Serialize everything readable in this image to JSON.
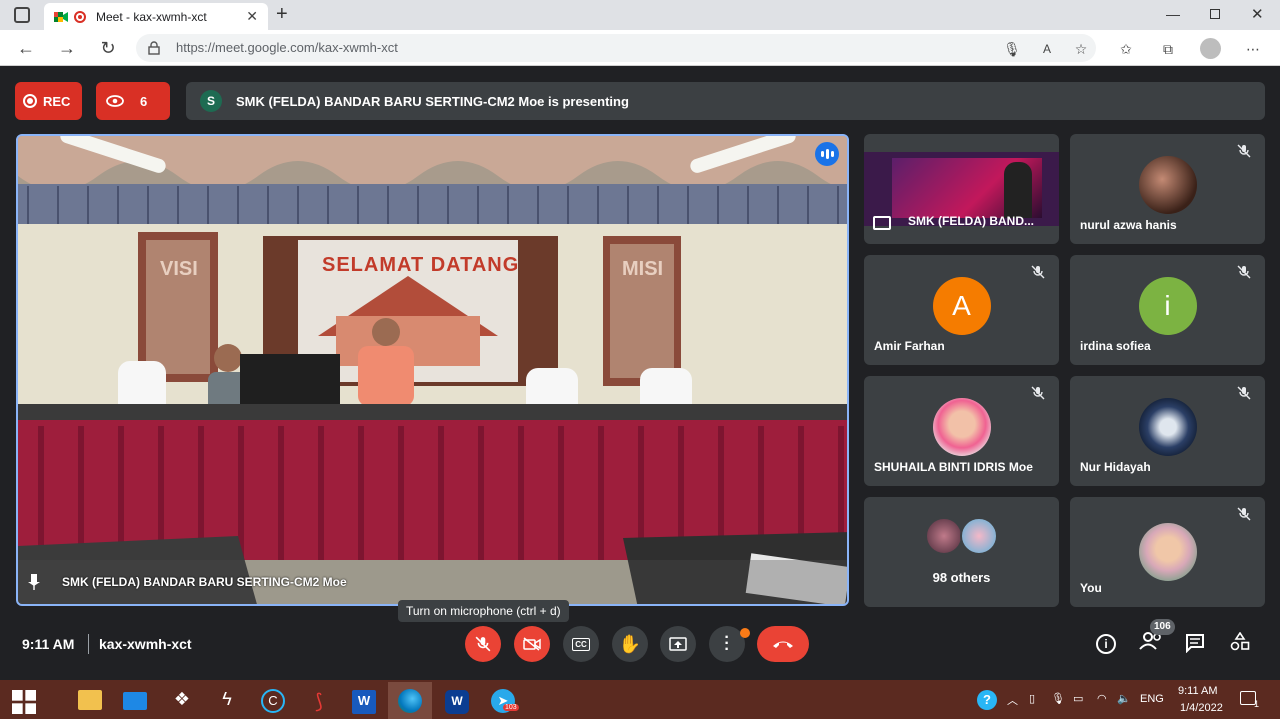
{
  "browser": {
    "tab_title": "Meet - kax-xwmh-xct",
    "new_tab_label": "+",
    "url": "https://meet.google.com/kax-xwmh-xct"
  },
  "meet": {
    "rec_label": "REC",
    "viewers_count": "6",
    "presenter_initial": "S",
    "presenting_text": "SMK (FELDA) BANDAR BARU SERTING-CM2 Moe is presenting",
    "main_video_name": "SMK (FELDA) BANDAR BARU SERTING-CM2 Moe",
    "scene_banner": "SELAMAT DATANG",
    "scene_left_board": "VISI",
    "scene_right_board": "MISI",
    "participants": [
      {
        "name": "SMK (FELDA) BAND...",
        "type": "presentation"
      },
      {
        "name": "nurul azwa hanis",
        "type": "photo"
      },
      {
        "name": "Amir Farhan",
        "type": "initial",
        "initial": "A",
        "color": "#f57c00"
      },
      {
        "name": "irdina sofiea",
        "type": "initial",
        "initial": "i",
        "color": "#7cb342"
      },
      {
        "name": "SHUHAILA BINTI IDRIS Moe",
        "type": "photo"
      },
      {
        "name": "Nur Hidayah",
        "type": "photo"
      },
      {
        "name": "98 others",
        "type": "others"
      },
      {
        "name": "You",
        "type": "photo"
      }
    ],
    "time": "9:11 AM",
    "meeting_code": "kax-xwmh-xct",
    "tooltip": "Turn on microphone (ctrl + d)",
    "people_count": "106"
  },
  "taskbar": {
    "lang": "ENG",
    "time": "9:11 AM",
    "date": "1/4/2022",
    "telegram_badge": "103",
    "notifications": "1"
  },
  "colors": {
    "accent_red": "#ea4335",
    "meet_bg": "#202124",
    "tile_bg": "#3c4043",
    "active_border": "#8ab4f8"
  }
}
